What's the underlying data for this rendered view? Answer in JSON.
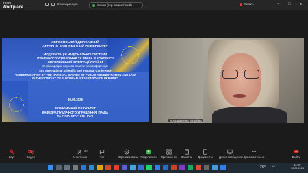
{
  "app": {
    "brand_top": "zoom",
    "brand_bottom": "Workplace"
  },
  "titlebar": {
    "meeting_label": "Конференция",
    "share_label": "Экран (Угр Башкатский)",
    "record_label": "Запись"
  },
  "slide": {
    "university": [
      "ХЕРСОНСЬКИЙ ДЕРЖАВНИЙ",
      "АГРАРНО-ЕКОНОМІЧНИЙ УНІВЕРСИТЕТ"
    ],
    "title_ua": [
      "МОДЕРНІЗАЦІЯ НАЦІОНАЛЬНОЇ СИСТЕМИ",
      "ПУБЛІЧНОГО УПРАВЛІННЯ ТА ПРАВА В КОНТЕКСТІ",
      "ЄВРОПЕЙСЬКОЇ ІНТЕГРАЦІЇ УКРАЇНИ",
      "III міжнародна науково-практична конференція"
    ],
    "title_en": [
      "III",
      "rd International Scientific and Practical Conference",
      "\"MODERNISATION OF THE NATIONAL SYSTEM OF PUBLIC ADMINISTRATION AND LAW",
      "IN THE CONTEXT OF EUROPEAN INTEGRATION OF UKRAINE\""
    ],
    "date": "30.05.2025",
    "faculty": [
      "ЕКОНОМІЧНИЙ ФАКУЛЬТЕТ",
      "КАФЕДРА ПУБЛІЧНОГО УПРАВЛІННЯ, ПРАВА",
      "ТА ГУМАНІТАРНИХ НАУК"
    ]
  },
  "camera": {
    "participant_name": "Ирга Шимена Ботыйиа"
  },
  "toolbar": {
    "items": [
      {
        "label": "Звук",
        "icon": "microphone-muted-icon"
      },
      {
        "label": "Видео",
        "icon": "video-muted-icon"
      },
      {
        "label": "Участники",
        "icon": "participants-icon",
        "count": "50"
      },
      {
        "label": "Чат",
        "icon": "chat-icon"
      },
      {
        "label": "Отреагировать",
        "icon": "react-icon"
      },
      {
        "label": "Поделиться",
        "icon": "share-icon"
      },
      {
        "label": "Приложения",
        "icon": "apps-icon"
      },
      {
        "label": "Заметки",
        "icon": "notes-icon"
      },
      {
        "label": "Документы",
        "icon": "docs-icon"
      },
      {
        "label": "Доска сообщений",
        "icon": "whiteboard-icon"
      },
      {
        "label": "Дополнительно",
        "icon": "more-icon"
      },
      {
        "label": "Выйти",
        "icon": "leave-icon"
      }
    ]
  },
  "taskbar": {
    "language": "УКР",
    "time": "11:29",
    "date": "30.05.2025"
  },
  "colors": {
    "slide_blue": "#3561c6",
    "accent_red": "#e33333",
    "leave_red": "#d93025"
  }
}
